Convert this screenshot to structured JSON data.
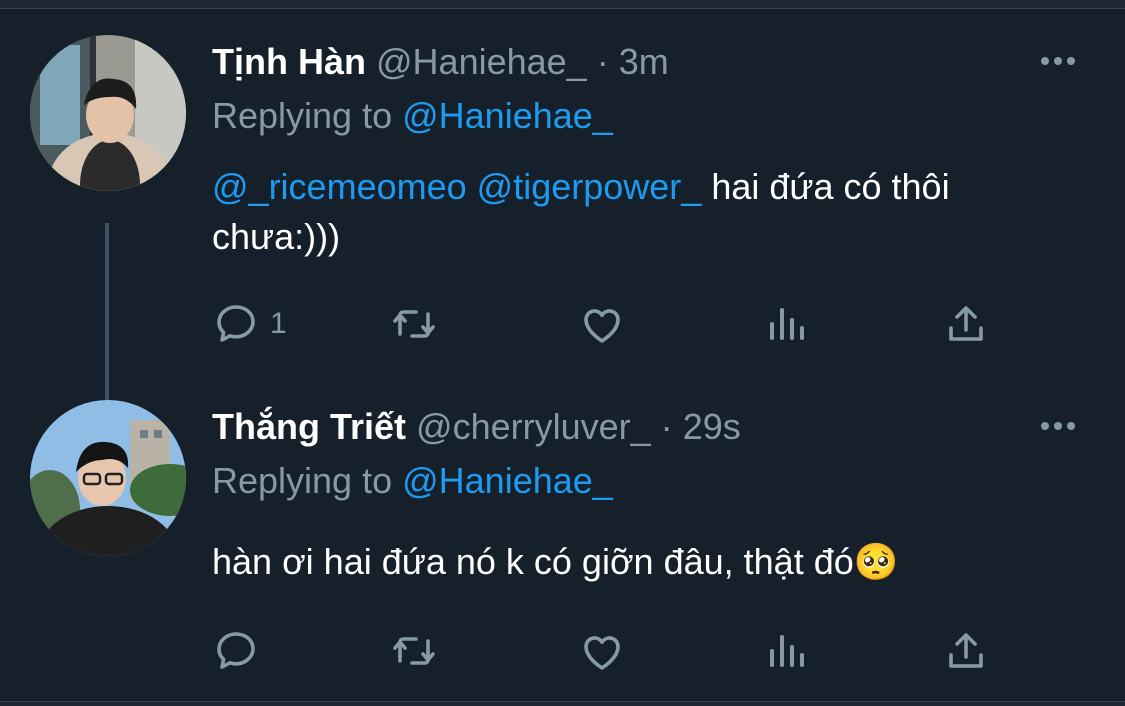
{
  "tweets": [
    {
      "name": "Tịnh Hàn",
      "handle": "@Haniehae_",
      "dot": "·",
      "time": "3m",
      "replying_prefix": "Replying to ",
      "replying_to": "@Haniehae_",
      "mention1": "@_ricemeomeo",
      "mention2": "@tigerpower_",
      "text": " hai đứa có thôi chưa:)))",
      "reply_count": "1"
    },
    {
      "name": "Thắng Triết",
      "handle": "@cherryluver_",
      "dot": "·",
      "time": "29s",
      "replying_prefix": "Replying to ",
      "replying_to": "@Haniehae_",
      "text": "hàn ơi hai đứa nó k có giỡn đâu, thật đó",
      "emoji": "🥺",
      "reply_count": ""
    }
  ],
  "icons": {
    "reply": "reply-icon",
    "retweet": "retweet-icon",
    "like": "heart-icon",
    "stats": "analytics-icon",
    "share": "share-icon",
    "more": "more-icon"
  },
  "colors": {
    "background": "#15202b",
    "secondary_text": "#8899a6",
    "link": "#1d9bf0"
  }
}
